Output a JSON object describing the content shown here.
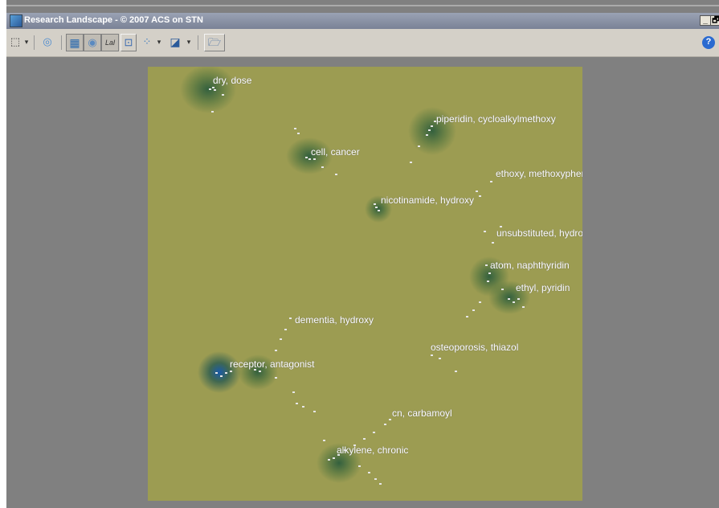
{
  "window": {
    "title": "Research Landscape - © 2007 ACS on STN",
    "minimize": "_",
    "restore": "🗗"
  },
  "toolbar": {
    "tools": [
      {
        "name": "select-tool-icon",
        "glyph": "⬚"
      },
      {
        "name": "dropdown-arrow-icon",
        "glyph": "▾"
      },
      {
        "name": "rotate-view-icon",
        "glyph": "◎"
      },
      {
        "name": "map-view-icon",
        "glyph": "▦"
      },
      {
        "name": "contour-view-icon",
        "glyph": "◉"
      },
      {
        "name": "label-toggle-icon",
        "glyph": "Lal"
      },
      {
        "name": "zoom-fit-icon",
        "glyph": "⊡"
      },
      {
        "name": "points-icon",
        "glyph": "⁘"
      },
      {
        "name": "dropdown-arrow-icon",
        "glyph": "▾"
      },
      {
        "name": "color-scheme-icon",
        "glyph": "◪"
      },
      {
        "name": "dropdown-arrow-icon",
        "glyph": "▾"
      },
      {
        "name": "open-folder-icon",
        "glyph": "🗁"
      }
    ],
    "help": "?"
  },
  "clusters": [
    {
      "label": "dry, dose"
    },
    {
      "label": "piperidin, cycloalkylmethoxy"
    },
    {
      "label": "cell, cancer"
    },
    {
      "label": "ethoxy, methoxyphenyl"
    },
    {
      "label": "nicotinamide, hydroxy"
    },
    {
      "label": "unsubstituted, hydrogen"
    },
    {
      "label": "atom, naphthyridin"
    },
    {
      "label": "ethyl, pyridin"
    },
    {
      "label": "dementia, hydroxy"
    },
    {
      "label": "osteoporosis, thiazol"
    },
    {
      "label": "receptor, antagonist"
    },
    {
      "label": "cn, carbamoyl"
    },
    {
      "label": "alkylene, chronic"
    }
  ],
  "colors": {
    "map_background": "#9c9c52",
    "frame_background": "#808080",
    "peak": "#1a5aa8",
    "label": "#ffffff"
  }
}
